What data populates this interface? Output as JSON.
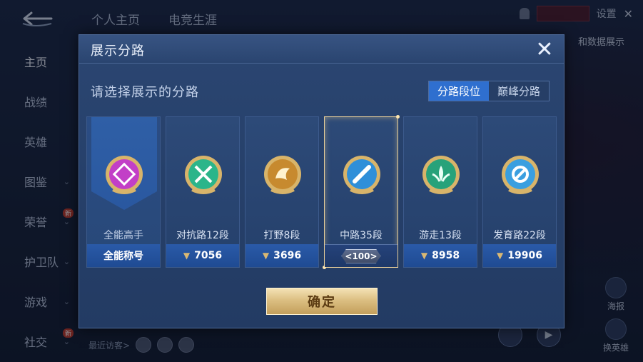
{
  "background": {
    "top_tabs": [
      "个人主页",
      "电竞生涯"
    ],
    "settings_label": "设置",
    "data_display_label": "和数据展示",
    "side_nav": [
      {
        "label": "主页",
        "active": true,
        "chevron": false,
        "badge": ""
      },
      {
        "label": "战绩",
        "active": false,
        "chevron": false,
        "badge": ""
      },
      {
        "label": "英雄",
        "active": false,
        "chevron": false,
        "badge": ""
      },
      {
        "label": "图鉴",
        "active": false,
        "chevron": true,
        "badge": ""
      },
      {
        "label": "荣誉",
        "active": false,
        "chevron": true,
        "badge": "新"
      },
      {
        "label": "护卫队",
        "active": false,
        "chevron": true,
        "badge": ""
      },
      {
        "label": "游戏",
        "active": false,
        "chevron": true,
        "badge": ""
      },
      {
        "label": "社交",
        "active": false,
        "chevron": true,
        "badge": "新"
      }
    ],
    "recent_visitors_label": "最近访客>",
    "right_buttons": [
      "海报",
      "换英雄"
    ]
  },
  "modal": {
    "title": "展示分路",
    "close_icon": "close-icon",
    "prompt": "请选择展示的分路",
    "toggle": [
      {
        "label": "分路段位",
        "active": true
      },
      {
        "label": "巅峰分路",
        "active": false
      }
    ],
    "cards": [
      {
        "id": "all",
        "label": "全能高手",
        "footer": "全能称号",
        "emblem_color": "#c23fc7",
        "emblem_icon": "all-round-emblem-icon",
        "selected": false
      },
      {
        "id": "clash",
        "label": "对抗路12段",
        "footer": "7056",
        "emblem_color": "#2bb58a",
        "emblem_icon": "clash-lane-emblem-icon",
        "selected": false
      },
      {
        "id": "jungle",
        "label": "打野8段",
        "footer": "3696",
        "emblem_color": "#c78a2f",
        "emblem_icon": "jungle-emblem-icon",
        "selected": false
      },
      {
        "id": "mid",
        "label": "中路35段",
        "footer": "<100>",
        "emblem_color": "#2f8fd9",
        "emblem_icon": "mid-lane-emblem-icon",
        "selected": true
      },
      {
        "id": "roam",
        "label": "游走13段",
        "footer": "8958",
        "emblem_color": "#27a27a",
        "emblem_icon": "roam-emblem-icon",
        "selected": false
      },
      {
        "id": "farm",
        "label": "发育路22段",
        "footer": "19906",
        "emblem_color": "#3a9fe0",
        "emblem_icon": "farm-lane-emblem-icon",
        "selected": false
      }
    ],
    "confirm_label": "确定"
  }
}
